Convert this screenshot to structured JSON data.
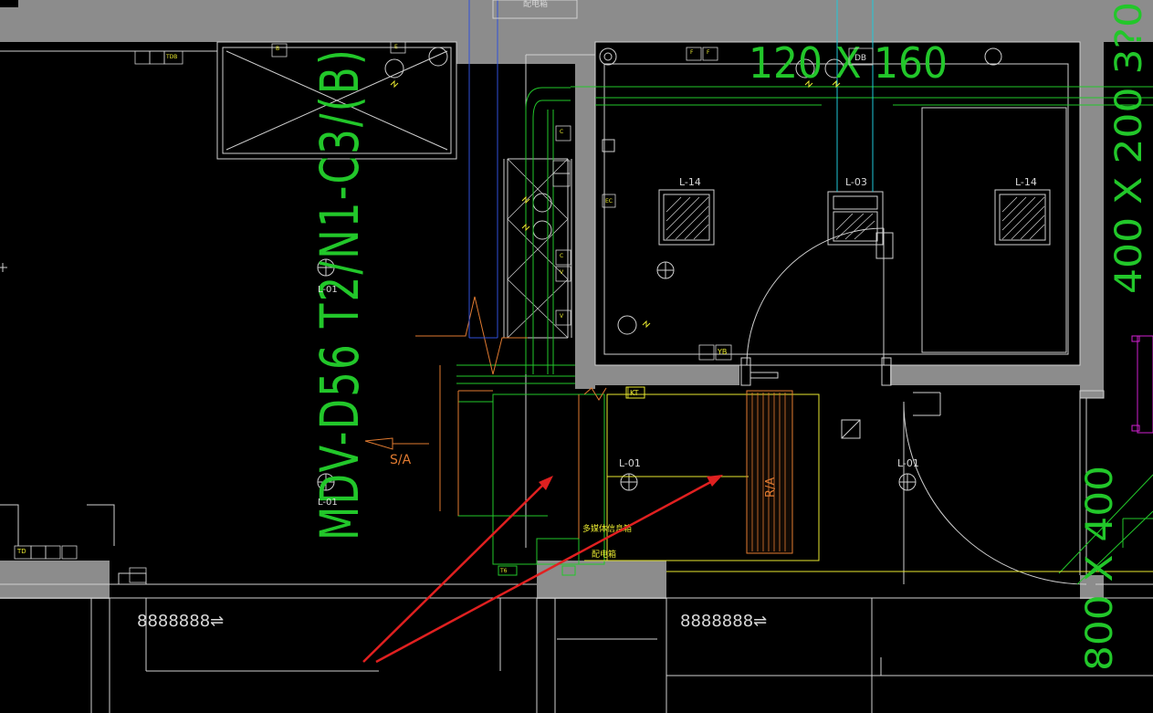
{
  "drawing": {
    "duct_spec_vertical": "MDV-D56 T2/N1-C3/(B)",
    "duct_size_top": "120 X 160",
    "duct_size_right_top": "400 X 200 3?0",
    "duct_size_right_bottom": "800 X 400",
    "supply_air_label": "S/A",
    "return_air_label": "R/A",
    "room_top_label": "配电箱",
    "bottom_box_label_1": "多媒体信息箱",
    "bottom_box_label_2": "配电箱",
    "fixture_labels": {
      "l14_left": "L-14",
      "l03": "L-03",
      "l14_right": "L-14",
      "l01_upper_left": "L-01",
      "l01_lower_left": "L-01",
      "l01_center": "L-01",
      "l01_right": "L-01"
    },
    "outlet_codes": {
      "kt": "KT",
      "yb": "YB",
      "ddb": "DB",
      "td": "TD",
      "tdb": "TDB",
      "c1": "C",
      "c2": "C",
      "v1": "V",
      "v2": "V",
      "b": "B",
      "e": "E",
      "ec": "EC",
      "f1": "F",
      "f2": "F",
      "te": "T6"
    },
    "bottom_text_left": "8888888⇌",
    "bottom_text_right": "8888888⇌",
    "colors": {
      "background": "#000000",
      "wall": "#8c8c8c",
      "line_white": "#d0d0d0",
      "line_green": "#22c72a",
      "line_yellow": "#e8e830",
      "line_orange": "#e07a30",
      "line_cyan": "#20c8d8",
      "line_blue": "#3050d8",
      "annotation_red": "#e02020",
      "magenta": "#d020d0"
    }
  }
}
